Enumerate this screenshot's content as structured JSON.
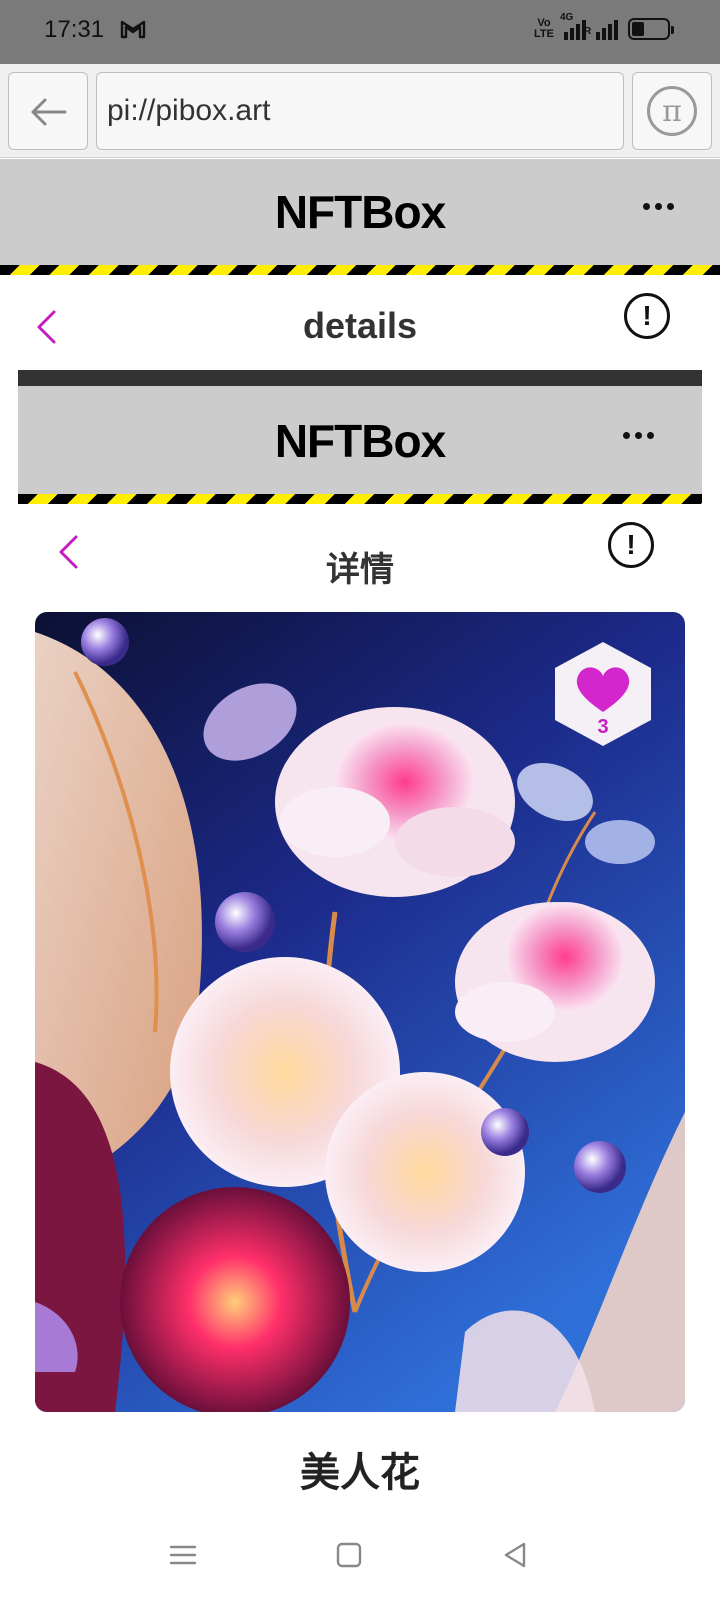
{
  "status_bar": {
    "time": "17:31",
    "mail_icon": "gmail-icon",
    "volte_label_top": "Vo",
    "volte_label_bottom": "LTE",
    "network_label": "4G",
    "roaming_label": "R",
    "battery_level": 0.35
  },
  "browser": {
    "url": "pi://pibox.art",
    "back_icon": "arrow-left-icon",
    "pi_icon": "pi-coin-icon",
    "pi_symbol": "π"
  },
  "app_header": {
    "title": "NFTBox",
    "menu_icon": "more-horizontal-icon"
  },
  "nav": {
    "title": "details",
    "info_symbol": "!"
  },
  "embedded": {
    "app_title": "NFTBox",
    "nav_title": "详情",
    "info_symbol": "!"
  },
  "artwork": {
    "name": "美人花",
    "like_count": "3"
  },
  "colors": {
    "accent": "#c51dbf",
    "header_bg": "#cccccc",
    "hazard_yellow": "#ffee00"
  }
}
